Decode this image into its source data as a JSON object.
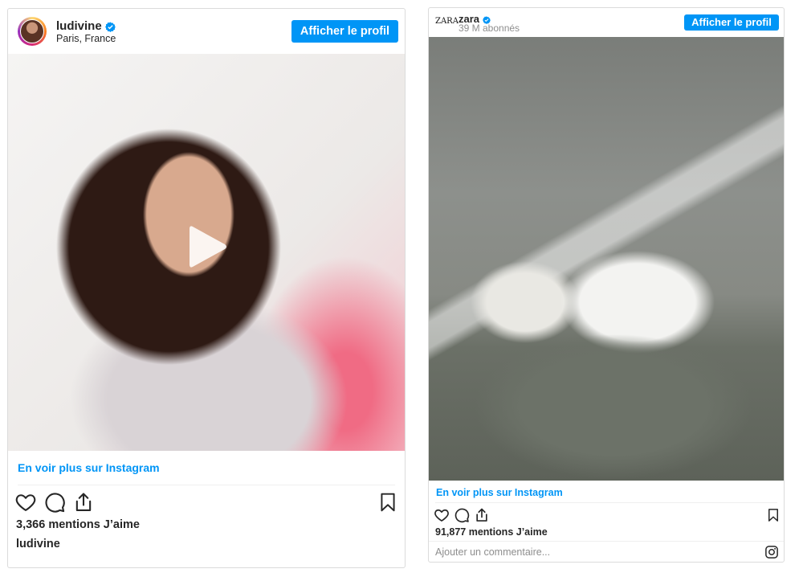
{
  "post1": {
    "username": "ludivine",
    "location": "Paris, France",
    "view_profile_label": "Afficher le profil",
    "see_more_label": "En voir plus sur Instagram",
    "likes_text": "3,366 mentions J’aime",
    "caption_user": "ludivine"
  },
  "post2": {
    "brand_logo": "ZARA",
    "username": "zara",
    "followers": "39 M abonnés",
    "view_profile_label": "Afficher le profil",
    "see_more_label": "En voir plus sur Instagram",
    "likes_text": "91,877 mentions J’aime",
    "comment_placeholder": "Ajouter un commentaire..."
  },
  "colors": {
    "accent": "#0095f6",
    "text": "#262626",
    "muted": "#8e8e8e",
    "border": "#dbdbdb"
  },
  "icons": [
    "verified-badge-icon",
    "play-icon",
    "heart-icon",
    "comment-icon",
    "share-icon",
    "bookmark-icon",
    "instagram-icon"
  ]
}
